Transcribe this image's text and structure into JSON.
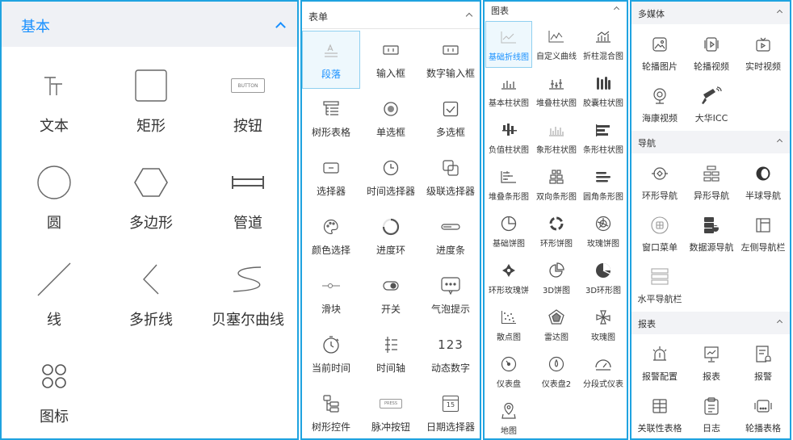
{
  "basic": {
    "title": "基本",
    "items": [
      {
        "label": "文本",
        "icon": "text-icon"
      },
      {
        "label": "矩形",
        "icon": "rectangle-icon"
      },
      {
        "label": "按钮",
        "icon": "button-icon",
        "icon_text": "BUTTON"
      },
      {
        "label": "圆",
        "icon": "circle-icon"
      },
      {
        "label": "多边形",
        "icon": "hexagon-icon"
      },
      {
        "label": "管道",
        "icon": "pipe-icon"
      },
      {
        "label": "线",
        "icon": "line-icon"
      },
      {
        "label": "多折线",
        "icon": "polyline-icon"
      },
      {
        "label": "贝塞尔曲线",
        "icon": "bezier-icon"
      },
      {
        "label": "图标",
        "icon": "icon-grid-icon"
      }
    ]
  },
  "form": {
    "title": "表单",
    "items": [
      {
        "label": "段落",
        "icon": "paragraph-icon",
        "selected": true
      },
      {
        "label": "输入框",
        "icon": "input-icon"
      },
      {
        "label": "数字输入框",
        "icon": "number-input-icon"
      },
      {
        "label": "树形表格",
        "icon": "tree-table-icon"
      },
      {
        "label": "单选框",
        "icon": "radio-icon"
      },
      {
        "label": "多选框",
        "icon": "checkbox-icon"
      },
      {
        "label": "选择器",
        "icon": "select-icon"
      },
      {
        "label": "时间选择器",
        "icon": "clock-icon"
      },
      {
        "label": "级联选择器",
        "icon": "cascade-icon"
      },
      {
        "label": "颜色选择",
        "icon": "palette-icon"
      },
      {
        "label": "进度环",
        "icon": "progress-ring-icon"
      },
      {
        "label": "进度条",
        "icon": "progress-bar-icon"
      },
      {
        "label": "滑块",
        "icon": "slider-icon"
      },
      {
        "label": "开关",
        "icon": "switch-icon"
      },
      {
        "label": "气泡提示",
        "icon": "bubble-icon"
      },
      {
        "label": "当前时间",
        "icon": "stopwatch-icon"
      },
      {
        "label": "时间轴",
        "icon": "timeline-icon"
      },
      {
        "label": "动态数字",
        "icon": "dynamic-number-icon",
        "icon_text": "123"
      },
      {
        "label": "树形控件",
        "icon": "tree-control-icon"
      },
      {
        "label": "脉冲按钮",
        "icon": "pulse-button-icon",
        "icon_text": "PRESS"
      },
      {
        "label": "日期选择器",
        "icon": "calendar-icon",
        "icon_text": "15"
      }
    ]
  },
  "charts": {
    "title": "图表",
    "items": [
      {
        "label": "基础折线图",
        "icon": "line-chart-icon",
        "selected": true
      },
      {
        "label": "自定义曲线",
        "icon": "custom-curve-icon"
      },
      {
        "label": "折柱混合图",
        "icon": "line-bar-mix-icon"
      },
      {
        "label": "基本柱状图",
        "icon": "bar-chart-icon"
      },
      {
        "label": "堆叠柱状图",
        "icon": "stacked-bar-icon"
      },
      {
        "label": "胶囊柱状图",
        "icon": "capsule-bar-icon"
      },
      {
        "label": "负值柱状图",
        "icon": "negative-bar-icon"
      },
      {
        "label": "象形柱状图",
        "icon": "pictorial-bar-icon"
      },
      {
        "label": "条形柱状图",
        "icon": "horizontal-bar-icon"
      },
      {
        "label": "堆叠条形图",
        "icon": "stacked-strip-icon"
      },
      {
        "label": "双向条形图",
        "icon": "bidirectional-bar-icon"
      },
      {
        "label": "圆角条形图",
        "icon": "rounded-bar-icon"
      },
      {
        "label": "基础饼图",
        "icon": "pie-icon"
      },
      {
        "label": "环形饼图",
        "icon": "donut-icon"
      },
      {
        "label": "玫瑰饼图",
        "icon": "rose-pie-icon"
      },
      {
        "label": "环形玫瑰饼",
        "icon": "ring-rose-icon"
      },
      {
        "label": "3D饼图",
        "icon": "pie-3d-icon"
      },
      {
        "label": "3D环形图",
        "icon": "donut-3d-icon"
      },
      {
        "label": "散点图",
        "icon": "scatter-icon"
      },
      {
        "label": "雷达图",
        "icon": "radar-icon"
      },
      {
        "label": "玫瑰图",
        "icon": "rose-icon"
      },
      {
        "label": "仪表盘",
        "icon": "gauge-icon"
      },
      {
        "label": "仪表盘2",
        "icon": "gauge2-icon"
      },
      {
        "label": "分段式仪表",
        "icon": "segmented-gauge-icon"
      },
      {
        "label": "地图",
        "icon": "map-pin-icon"
      }
    ]
  },
  "media": {
    "title": "多媒体",
    "items": [
      {
        "label": "轮播图片",
        "icon": "image-carousel-icon"
      },
      {
        "label": "轮播视频",
        "icon": "video-carousel-icon"
      },
      {
        "label": "实时视频",
        "icon": "live-video-icon"
      },
      {
        "label": "海康视频",
        "icon": "hikvision-camera-icon"
      },
      {
        "label": "大华ICC",
        "icon": "dahua-camera-icon"
      }
    ]
  },
  "nav": {
    "title": "导航",
    "items": [
      {
        "label": "环形导航",
        "icon": "ring-nav-icon"
      },
      {
        "label": "异形导航",
        "icon": "special-nav-icon"
      },
      {
        "label": "半球导航",
        "icon": "hemisphere-nav-icon"
      },
      {
        "label": "窗口菜单",
        "icon": "window-menu-icon"
      },
      {
        "label": "数据源导航",
        "icon": "datasource-nav-icon"
      },
      {
        "label": "左侧导航栏",
        "icon": "left-nav-icon"
      },
      {
        "label": "水平导航栏",
        "icon": "horizontal-nav-icon"
      }
    ]
  },
  "report": {
    "title": "报表",
    "items": [
      {
        "label": "报警配置",
        "icon": "alarm-config-icon"
      },
      {
        "label": "报表",
        "icon": "report-icon"
      },
      {
        "label": "报警",
        "icon": "alarm-icon"
      },
      {
        "label": "关联性表格",
        "icon": "related-table-icon"
      },
      {
        "label": "日志",
        "icon": "log-icon"
      },
      {
        "label": "轮播表格",
        "icon": "carousel-table-icon"
      }
    ]
  },
  "colors": {
    "accent": "#1890ff",
    "border": "#1fa3e0",
    "icon": "#555555",
    "section_bg": "#f2f3f6"
  }
}
